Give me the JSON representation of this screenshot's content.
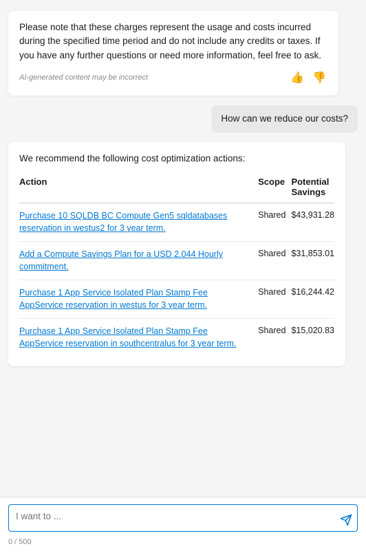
{
  "chat": {
    "assistant_message_1": {
      "text": "Please note that these charges represent the usage and costs incurred during the specified time period and do not include any credits or taxes. If you have any further questions or need more information, feel free to ask.",
      "disclaimer": "AI-generated content may be incorrect"
    },
    "user_message_1": {
      "text": "How can we reduce our costs?"
    },
    "assistant_message_2": {
      "intro": "We recommend the following cost optimization actions:",
      "table": {
        "headers": [
          "Action",
          "Scope",
          "Potential Savings"
        ],
        "rows": [
          {
            "action": "Purchase 10 SQLDB BC Compute Gen5 sqldatabases reservation in westus2 for 3 year term.",
            "scope": "Shared",
            "savings": "$43,931.28"
          },
          {
            "action": "Add a Compute Savings Plan for a USD 2.044 Hourly commitment.",
            "scope": "Shared",
            "savings": "$31,853.01"
          },
          {
            "action": "Purchase 1 App Service Isolated Plan Stamp Fee AppService reservation in westus for 3 year term.",
            "scope": "Shared",
            "savings": "$16,244.42"
          },
          {
            "action": "Purchase 1 App Service Isolated Plan Stamp Fee AppService reservation in southcentralus for 3 year term.",
            "scope": "Shared",
            "savings": "$15,020.83"
          }
        ]
      }
    },
    "input": {
      "placeholder": "I want to ...",
      "char_count": "0 / 500"
    }
  }
}
